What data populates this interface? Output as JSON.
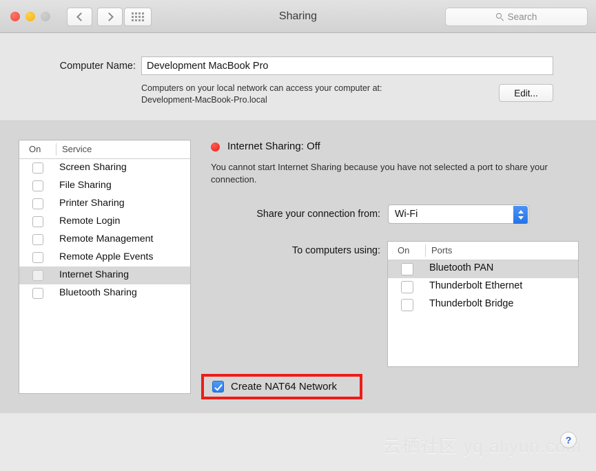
{
  "window": {
    "title": "Sharing",
    "traffic_lights": [
      "close-red",
      "minimize-yellow",
      "zoom-gray-disabled"
    ],
    "nav_back_icon": "chevron-left-icon",
    "nav_forward_icon": "chevron-right-icon",
    "show_all_icon": "grid-icon"
  },
  "search": {
    "placeholder": "Search",
    "value": "",
    "icon": "search-icon"
  },
  "computer_name": {
    "label": "Computer Name:",
    "value": "Development MacBook Pro",
    "note_line1": "Computers on your local network can access your computer at:",
    "note_line2": "Development-MacBook-Pro.local",
    "edit_button": "Edit..."
  },
  "services_table": {
    "columns": [
      "On",
      "Service"
    ],
    "rows": [
      {
        "label": "Screen Sharing",
        "on": false,
        "selected": false
      },
      {
        "label": "File Sharing",
        "on": false,
        "selected": false
      },
      {
        "label": "Printer Sharing",
        "on": false,
        "selected": false
      },
      {
        "label": "Remote Login",
        "on": false,
        "selected": false
      },
      {
        "label": "Remote Management",
        "on": false,
        "selected": false
      },
      {
        "label": "Remote Apple Events",
        "on": false,
        "selected": false
      },
      {
        "label": "Internet Sharing",
        "on": false,
        "selected": true
      },
      {
        "label": "Bluetooth Sharing",
        "on": false,
        "selected": false
      }
    ]
  },
  "detail": {
    "status_title": "Internet Sharing: Off",
    "status_color": "#e8201a",
    "status_icon": "status-dot-off",
    "status_description": "You cannot start Internet Sharing because you have not selected a port to share your connection.",
    "share_from_label": "Share your connection from:",
    "share_from_value": "Wi-Fi",
    "share_from_options": [
      "Wi-Fi"
    ],
    "to_computers_label": "To computers using:"
  },
  "ports_table": {
    "columns": [
      "On",
      "Ports"
    ],
    "rows": [
      {
        "label": "Bluetooth PAN",
        "on": false,
        "selected": true
      },
      {
        "label": "Thunderbolt Ethernet",
        "on": false,
        "selected": false
      },
      {
        "label": "Thunderbolt Bridge",
        "on": false,
        "selected": false
      }
    ]
  },
  "nat64": {
    "label": "Create NAT64 Network",
    "checked": true,
    "highlight_color": "#ee1c17",
    "checkbox_color": "#2c7de9"
  },
  "footer": {
    "watermark": "云栖社区 yq.aliyun.com",
    "help_label": "?",
    "help_icon": "help-icon"
  }
}
